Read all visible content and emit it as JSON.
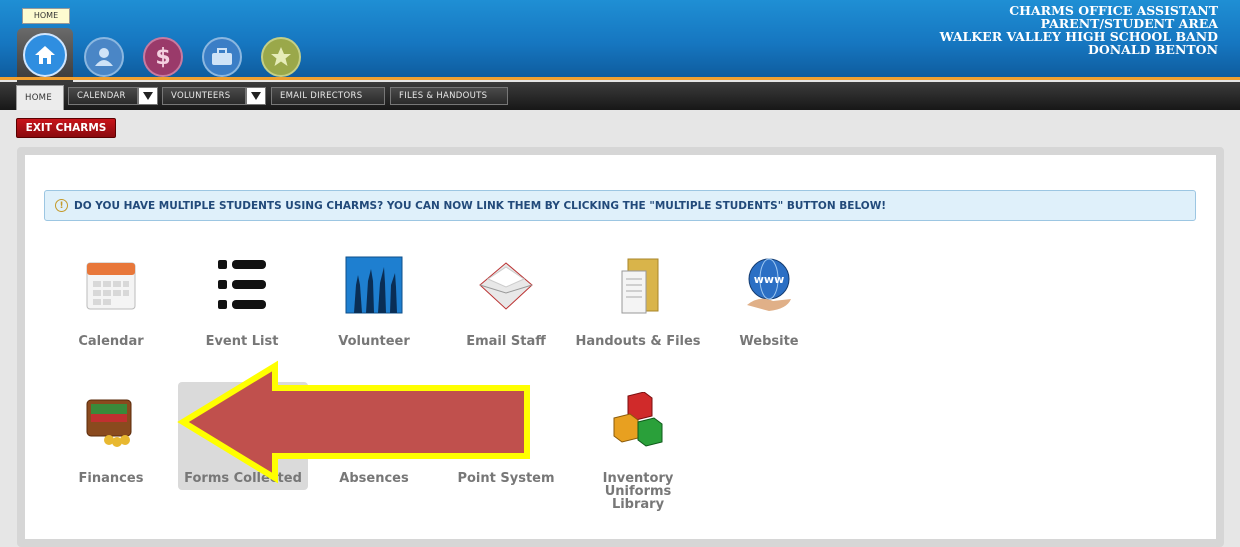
{
  "header": {
    "home_tooltip": "HOME",
    "app_name": "CHARMS OFFICE ASSISTANT",
    "area": "PARENT/STUDENT AREA",
    "school": "WALKER VALLEY HIGH SCHOOL BAND",
    "user": "DONALD BENTON",
    "icons": [
      "home-icon",
      "user-icon",
      "dollar-icon",
      "briefcase-icon",
      "star-icon"
    ]
  },
  "nav": {
    "home": "HOME",
    "calendar": "CALENDAR",
    "volunteers": "VOLUNTEERS",
    "email_directors": "EMAIL DIRECTORS",
    "files_handouts": "FILES & HANDOUTS"
  },
  "exit_button": "EXIT CHARMS",
  "notice": "DO YOU HAVE MULTIPLE STUDENTS USING CHARMS? YOU CAN NOW LINK THEM BY CLICKING THE \"MULTIPLE STUDENTS\" BUTTON BELOW!",
  "tiles_row1": [
    "Calendar",
    "Event List",
    "Volunteer",
    "Email Staff",
    "Handouts & Files",
    "Website"
  ],
  "tiles_row2": [
    "Finances",
    "Forms Collected",
    "Absences",
    "Point System",
    "Inventory\nUniforms\nLibrary"
  ],
  "colors": {
    "accent_blue": "#1676c0",
    "exit_red": "#b01016",
    "arrow_fill": "#c0504d",
    "arrow_border": "#ffff00"
  }
}
